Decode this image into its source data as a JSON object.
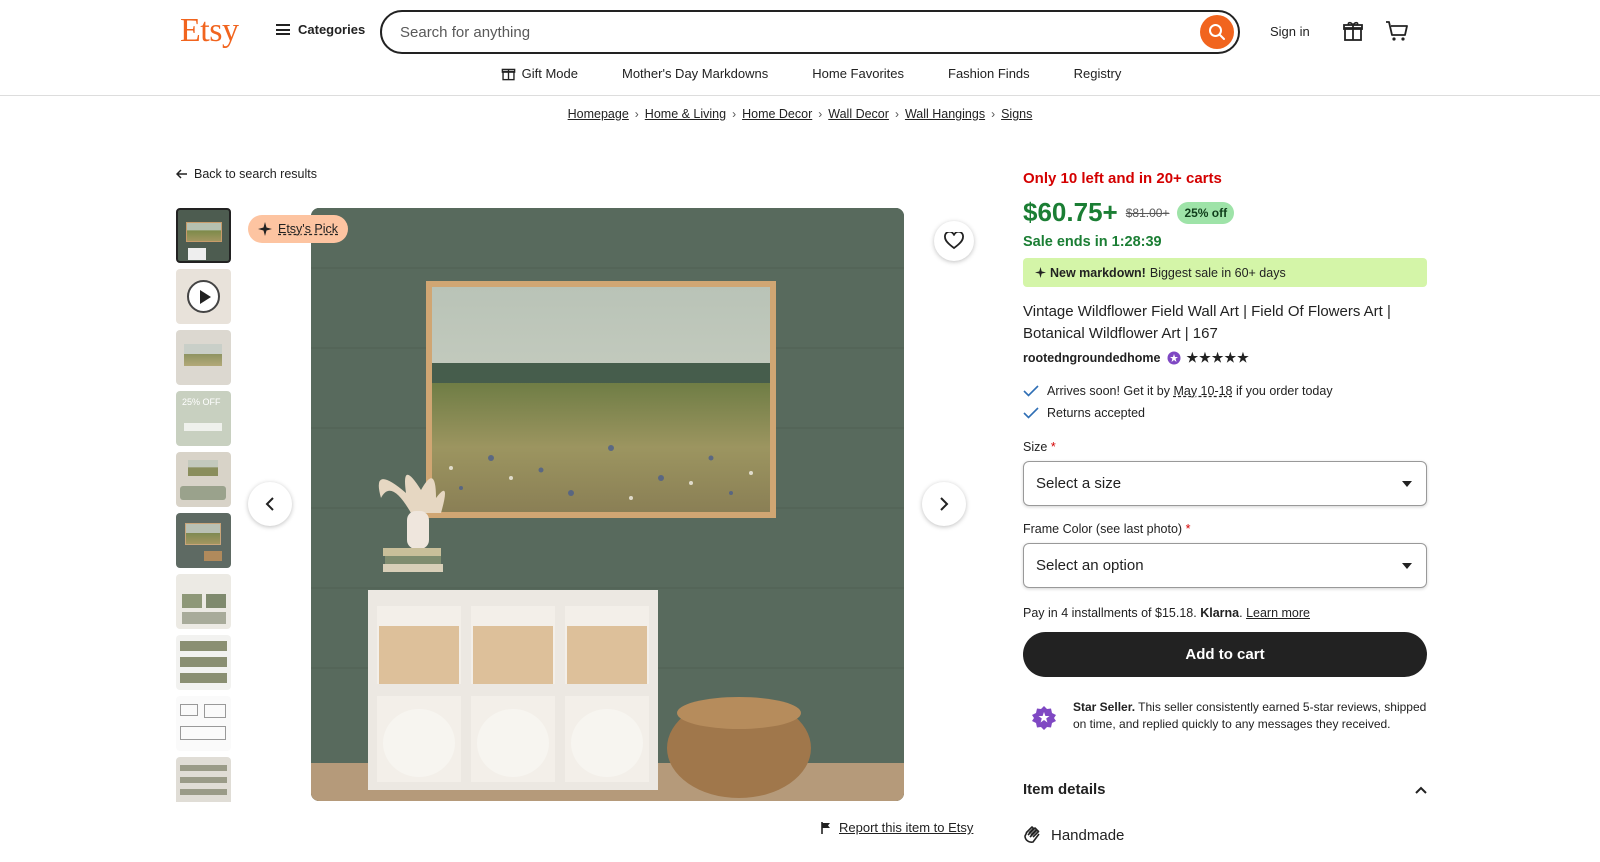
{
  "header": {
    "logo": "Etsy",
    "categories_label": "Categories",
    "search_placeholder": "Search for anything",
    "signin_label": "Sign in"
  },
  "subnav": [
    "Gift Mode",
    "Mother's Day Markdowns",
    "Home Favorites",
    "Fashion Finds",
    "Registry"
  ],
  "breadcrumb": [
    "Homepage",
    "Home & Living",
    "Home Decor",
    "Wall Decor",
    "Wall Hangings",
    "Signs"
  ],
  "back_label": "Back to search results",
  "etsy_pick_label": "Etsy's Pick",
  "report_label": "Report this item to Etsy",
  "product": {
    "stock_text": "Only 10 left and in 20+ carts",
    "price": "$60.75+",
    "original_price": "$81.00+",
    "discount": "25% off",
    "sale_ends": "Sale ends in 1:28:39",
    "markdown_bold": "New markdown!",
    "markdown_text": "Biggest sale in 60+ days",
    "title": "Vintage Wildflower Field Wall Art | Field Of Flowers Art | Botanical Wildflower Art | 167",
    "seller": "rootedngroundedhome",
    "rating_stars": "★★★★★",
    "arrives_prefix": "Arrives soon! Get it by",
    "arrives_date": "May 10-18",
    "arrives_suffix": "if you order today",
    "returns": "Returns accepted",
    "size_label": "Size",
    "size_placeholder": "Select a size",
    "frame_label": "Frame Color (see last photo)",
    "frame_placeholder": "Select an option",
    "required_mark": "*",
    "klarna_text": "Pay in 4 installments of $15.18.",
    "klarna_brand": "Klarna",
    "klarna_link": "Learn more",
    "add_to_cart": "Add to cart",
    "star_seller_bold": "Star Seller.",
    "star_seller_text": "This seller consistently earned 5-star reviews, shipped on time, and replied quickly to any messages they received.",
    "item_details": "Item details",
    "handmade": "Handmade"
  },
  "colors": {
    "brand": "#F1641E",
    "price_green": "#1B7E34",
    "stock_red": "#D40000",
    "markdown_bg": "#D4F5A8",
    "star_seller_purple": "#7F48C3"
  }
}
